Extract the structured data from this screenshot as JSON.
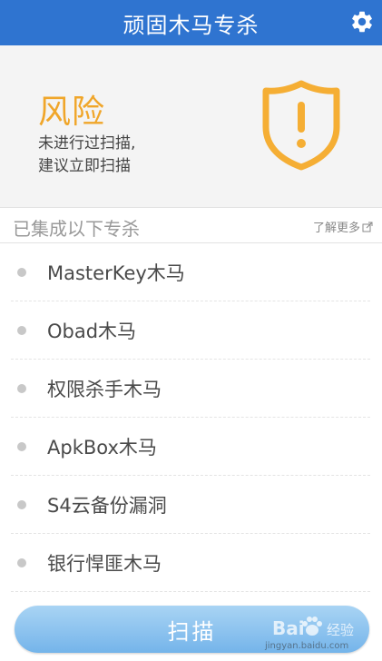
{
  "header": {
    "title": "顽固木马专杀",
    "settings_icon": "gear-icon"
  },
  "risk": {
    "title": "风险",
    "desc_line1": "未进行过扫描,",
    "desc_line2": "建议立即扫描",
    "icon": "shield-alert-icon",
    "accent_color": "#f0a62a"
  },
  "section": {
    "label": "已集成以下专杀",
    "more_label": "了解更多",
    "more_icon": "external-link-icon"
  },
  "items": [
    {
      "label": "MasterKey木马"
    },
    {
      "label": "Obad木马"
    },
    {
      "label": "权限杀手木马"
    },
    {
      "label": "ApkBox木马"
    },
    {
      "label": "S4云备份漏洞"
    },
    {
      "label": "银行悍匪木马"
    }
  ],
  "scan_button": {
    "label": "扫描"
  },
  "watermark": {
    "brand": "Bai",
    "brand_suffix": "经验",
    "url": "jingyan.baidu.com"
  },
  "colors": {
    "header": "#2f74d0",
    "button": "#8ec6f0"
  }
}
